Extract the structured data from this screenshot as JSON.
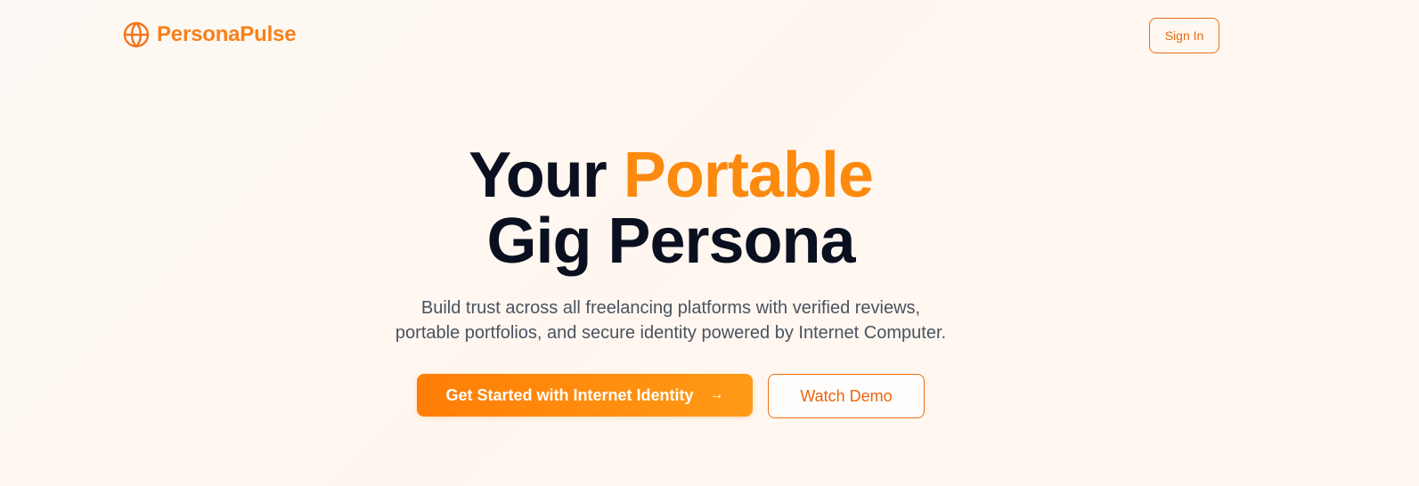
{
  "header": {
    "brand_name": "PersonaPulse",
    "brand_icon": "globe-icon",
    "sign_in_label": "Sign In"
  },
  "hero": {
    "title_part1": "Your",
    "title_accent": "Portable",
    "title_line2": "Gig Persona",
    "subtitle_line1": "Build trust across all freelancing platforms with verified reviews,",
    "subtitle_line2": "portable portfolios, and secure identity powered by Internet Computer.",
    "primary_cta_label": "Get Started with Internet Identity",
    "primary_cta_icon": "arrow-right-icon",
    "secondary_cta_label": "Watch Demo"
  },
  "colors": {
    "accent": "#fb8a0e",
    "accent_dark": "#ea650c",
    "heading": "#0b1020",
    "body_text": "#4a5260",
    "background": "#fef9f4"
  }
}
